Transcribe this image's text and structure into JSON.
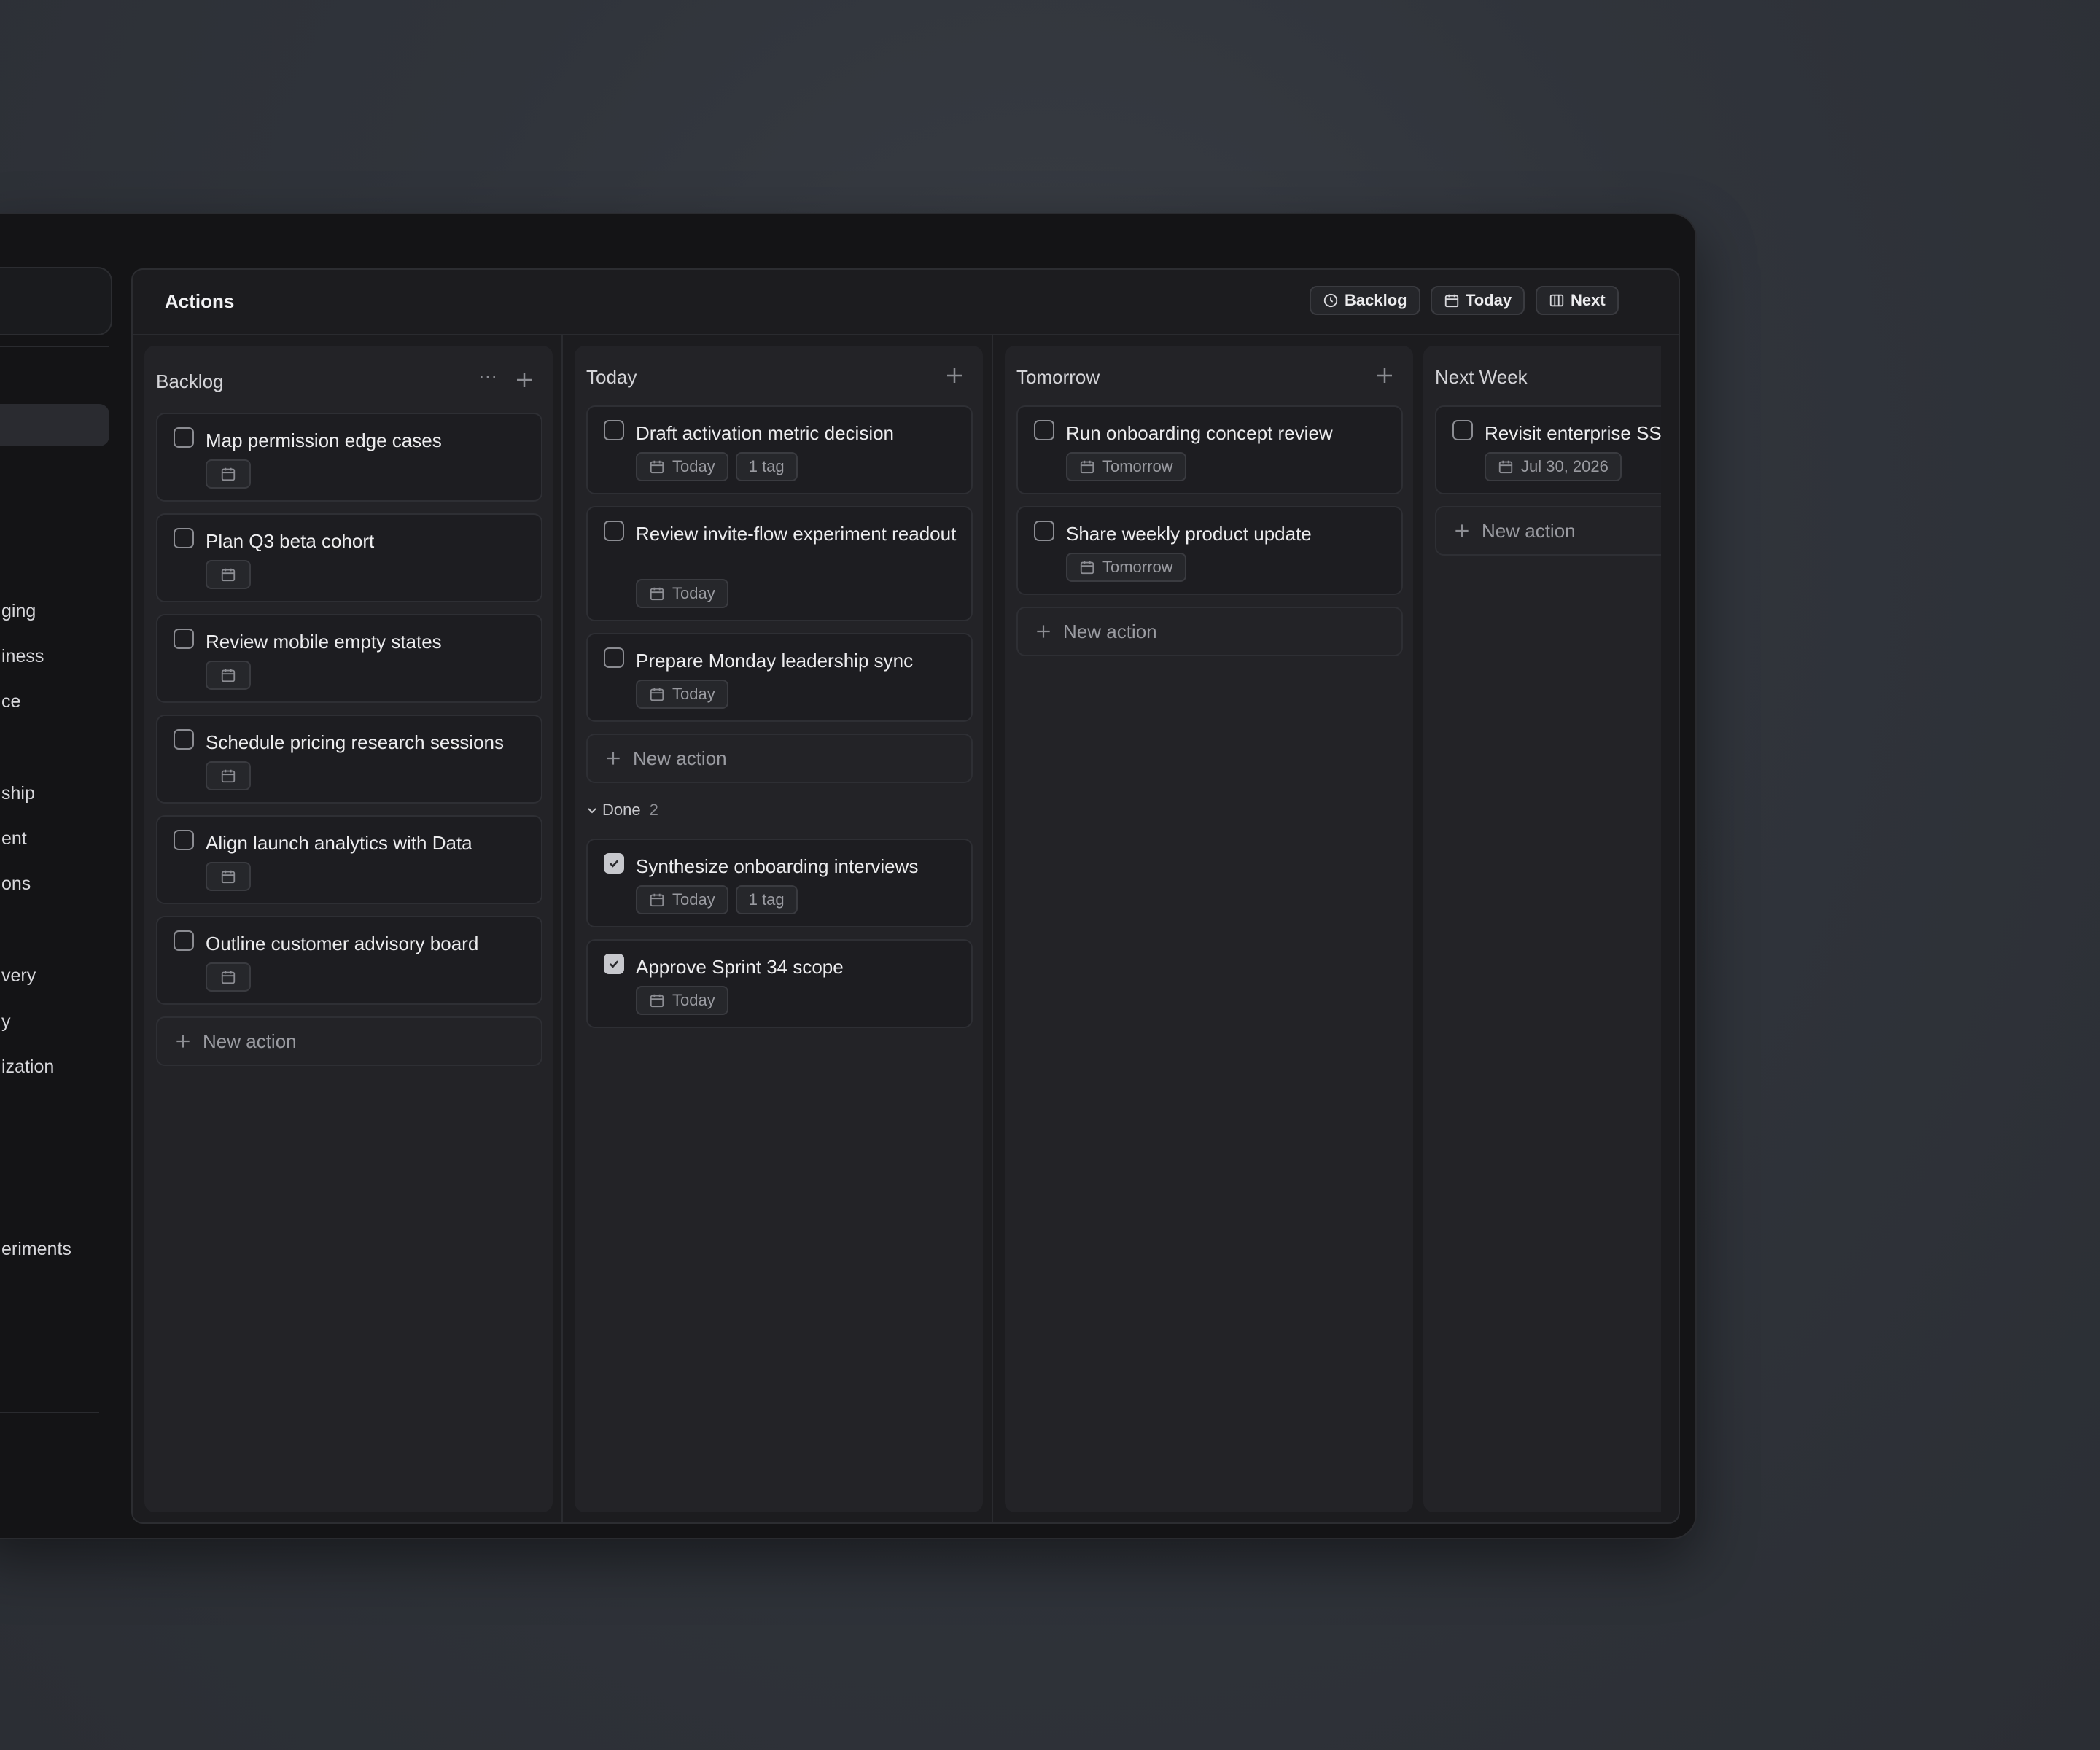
{
  "sidebar": {
    "items": [
      "ging",
      "iness",
      "ce",
      "ship",
      "ent",
      "ons",
      "very",
      "y",
      "ization",
      "eriments"
    ]
  },
  "header": {
    "title": "Actions",
    "view_buttons": [
      {
        "label": "Backlog",
        "icon": "clock-icon"
      },
      {
        "label": "Today",
        "icon": "calendar-icon"
      },
      {
        "label": "Next",
        "icon": "columns-icon"
      }
    ]
  },
  "columns": [
    {
      "title": "Backlog",
      "cards": [
        {
          "title": "Map permission edge cases"
        },
        {
          "title": "Plan Q3 beta cohort"
        },
        {
          "title": "Review mobile empty states"
        },
        {
          "title": "Schedule pricing research sessions"
        },
        {
          "title": "Align launch analytics with Data"
        },
        {
          "title": "Outline customer advisory board"
        }
      ],
      "new_action": "New action"
    },
    {
      "title": "Today",
      "cards": [
        {
          "title": "Draft activation metric decision",
          "date": "Today",
          "tag": "1 tag"
        },
        {
          "title": "Review invite-flow experiment readout",
          "date": "Today"
        },
        {
          "title": "Prepare Monday leadership sync",
          "date": "Today"
        }
      ],
      "new_action": "New action",
      "done_label": "Done",
      "done_count": "2",
      "done_cards": [
        {
          "title": "Synthesize onboarding interviews",
          "date": "Today",
          "tag": "1 tag"
        },
        {
          "title": "Approve Sprint 34 scope",
          "date": "Today"
        }
      ]
    },
    {
      "title": "Tomorrow",
      "cards": [
        {
          "title": "Run onboarding concept review",
          "date": "Tomorrow"
        },
        {
          "title": "Share weekly product update",
          "date": "Tomorrow"
        }
      ],
      "new_action": "New action"
    },
    {
      "title": "Next Week",
      "cards": [
        {
          "title": "Revisit enterprise SSO",
          "date": "Jul 30, 2026"
        }
      ],
      "new_action": "New action"
    }
  ]
}
